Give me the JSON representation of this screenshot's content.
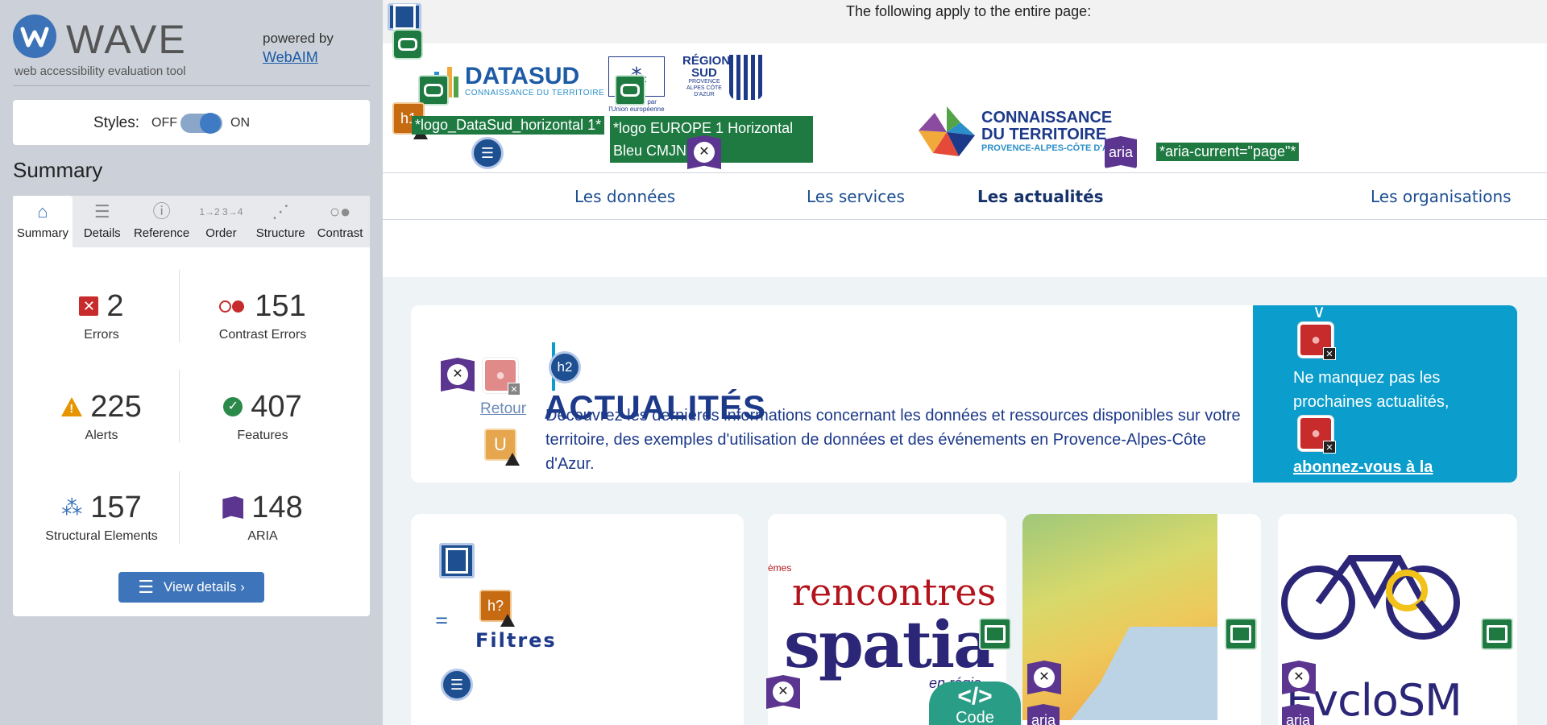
{
  "wave": {
    "title": "WAVE",
    "subtitle": "web accessibility evaluation tool",
    "powered_by": "powered by",
    "webaim_link": "WebAIM",
    "styles_label": "Styles:",
    "styles_off": "OFF",
    "styles_on": "ON",
    "summary_heading": "Summary",
    "tabs": [
      {
        "label": "Summary",
        "icon": "home-icon"
      },
      {
        "label": "Details",
        "icon": "list-icon"
      },
      {
        "label": "Reference",
        "icon": "info-icon"
      },
      {
        "label": "Order",
        "icon": "order-icon"
      },
      {
        "label": "Structure",
        "icon": "structure-icon"
      },
      {
        "label": "Contrast",
        "icon": "contrast-icon"
      }
    ],
    "stats": {
      "errors": {
        "value": "2",
        "label": "Errors"
      },
      "contrast_errors": {
        "value": "151",
        "label": "Contrast Errors"
      },
      "alerts": {
        "value": "225",
        "label": "Alerts"
      },
      "features": {
        "value": "407",
        "label": "Features"
      },
      "structural": {
        "value": "157",
        "label": "Structural Elements"
      },
      "aria": {
        "value": "148",
        "label": "ARIA"
      }
    },
    "view_details": "View details ›",
    "colors": {
      "error": "#c72b2b",
      "alert": "#e69500",
      "feature": "#2b8a4a",
      "structure": "#3b72b8",
      "aria": "#5b3590"
    }
  },
  "page": {
    "notice": "The following apply to the entire page:",
    "logos": {
      "datasud_name": "DATASUD",
      "datasud_sub": "CONNAISSANCE DU TERRITOIRE",
      "eu_text": "Cofinancé par l'Union européenne",
      "region_name": "RÉGION SUD",
      "region_small": "PROVENCE ALPES CÔTE D'AZUR",
      "cdt_line1": "CONNAISSANCE",
      "cdt_line2": "DU TERRITOIRE",
      "cdt_line3": "PROVENCE-ALPES-CÔTE D'AZUR"
    },
    "alt_tags": {
      "datasud": "*logo_DataSud_horizontal 1*",
      "europe": "*logo EUROPE 1 Horizontal Bleu CMJN 1*",
      "aria_current": "*aria-current=\"page\"*"
    },
    "nav": [
      {
        "label": "Les données"
      },
      {
        "label": "Les services"
      },
      {
        "label": "Les actualités",
        "current": true
      },
      {
        "label": "Les organisations"
      }
    ],
    "hero": {
      "retour": "Retour",
      "title": "ACTUALITÉS",
      "description": "Découvrez les dernières informations concernant les données et ressources disponibles sur votre territoire, des exemples d'utilisation de données et des événements en Provence-Alpes-Côte d'Azur.",
      "cta_text": "Ne manquez pas les prochaines actualités,",
      "cta_link": "abonnez-vous à la"
    },
    "filters_heading": "Filtres",
    "card1_text_a": "rencontres",
    "card1_text_b": "spatia",
    "card1_text_c": "en régio",
    "card1_prefix": "èmes",
    "card3_text": "ÈvcloSM",
    "code_button": "Code",
    "code_icon": "</>",
    "overlay": {
      "h1": "h1",
      "h2": "h2",
      "h_unknown": "h?",
      "aria": "aria",
      "u": "U"
    }
  }
}
